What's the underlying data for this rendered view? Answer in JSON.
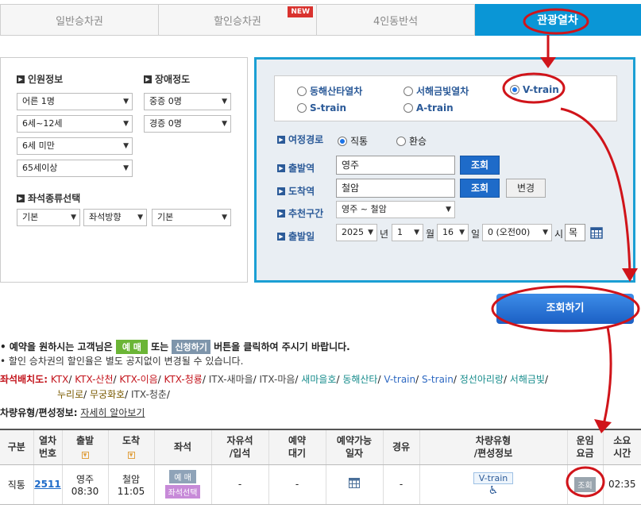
{
  "tabs": [
    {
      "label": "일반승차권"
    },
    {
      "label": "할인승차권",
      "badge": "NEW"
    },
    {
      "label": "4인동반석"
    },
    {
      "label": "관광열차"
    }
  ],
  "left": {
    "passenger_title": "인원정보",
    "disability_title": "장애정도",
    "passenger_selects": [
      "어른 1명",
      "6세~12세",
      "6세 미만",
      "65세이상"
    ],
    "disability_selects": [
      "중증 0명",
      "경증 0명"
    ],
    "seat_title": "좌석종류선택",
    "seat_selects": [
      "기본",
      "좌석방향",
      "기본"
    ]
  },
  "right": {
    "trains": [
      "동해산타열차",
      "서해금빛열차",
      "V-train",
      "S-train",
      "A-train"
    ],
    "selected_train": "V-train",
    "route_label": "여정경로",
    "route_options": [
      "직통",
      "환승"
    ],
    "dep_label": "출발역",
    "dep_value": "영주",
    "arr_label": "도착역",
    "arr_value": "철암",
    "lookup": "조회",
    "change": "변경",
    "rec_label": "추천구간",
    "rec_value": "영주 ~ 철암",
    "date_label": "출발일",
    "year": "2025",
    "year_unit": "년",
    "month": "1",
    "month_unit": "월",
    "day": "16",
    "day_unit": "일",
    "hour": "0 (오전00)",
    "hour_unit": "시",
    "weekday": "목"
  },
  "search_button": "조회하기",
  "notes": {
    "line1_pre": "예약을 원하시는 고객님은",
    "line1_btn1": "예 매",
    "line1_mid": "또는",
    "line1_btn2": "신청하기",
    "line1_post": "버튼을 클릭하여 주시기 바랍니다.",
    "line2": "할인 승차권의 할인율은 별도 공지없이 변경될 수 있습니다.",
    "seat_title": "좌석배치도:",
    "seat_links_1": [
      {
        "t": "KTX",
        "c": "red"
      },
      {
        "t": "KTX-산천",
        "c": "red"
      },
      {
        "t": "KTX-이음",
        "c": "red"
      },
      {
        "t": "KTX-청룡",
        "c": "red"
      },
      {
        "t": "ITX-새마을",
        "c": "dk"
      },
      {
        "t": "ITX-마음",
        "c": "dk"
      },
      {
        "t": "새마을호",
        "c": "teal"
      },
      {
        "t": "동해산타",
        "c": "teal"
      },
      {
        "t": "V-train",
        "c": "blue"
      },
      {
        "t": "S-train",
        "c": "blue"
      },
      {
        "t": "정선아리랑",
        "c": "teal"
      },
      {
        "t": "서해금빛",
        "c": "teal"
      }
    ],
    "seat_links_2": [
      {
        "t": "누리로",
        "c": "brown"
      },
      {
        "t": "무궁화호",
        "c": "brown"
      },
      {
        "t": "ITX-청춘",
        "c": "dk"
      }
    ],
    "vehicle_title": "차량유형/편성정보:",
    "vehicle_link": "자세히 알아보기"
  },
  "table": {
    "headers": [
      [
        "구분"
      ],
      [
        "열차",
        "번호"
      ],
      [
        "출발"
      ],
      [
        "도착"
      ],
      [
        "좌석"
      ],
      [
        "자유석",
        "/입석"
      ],
      [
        "예약",
        "대기"
      ],
      [
        "예약가능",
        "일자"
      ],
      [
        "경유"
      ],
      [
        "차량유형",
        "/편성정보"
      ],
      [
        "운임",
        "요금"
      ],
      [
        "소요",
        "시간"
      ]
    ],
    "row": {
      "type": "직통",
      "train_no": "2511",
      "dep_station": "영주",
      "dep_time": "08:30",
      "arr_station": "철암",
      "arr_time": "11:05",
      "seat_btn1": "예 매",
      "seat_btn2": "좌석선택",
      "free_seat": "-",
      "waiting": "-",
      "via": "-",
      "vehicle": "V-train",
      "fare_btn": "조회",
      "duration": "02:35"
    }
  }
}
